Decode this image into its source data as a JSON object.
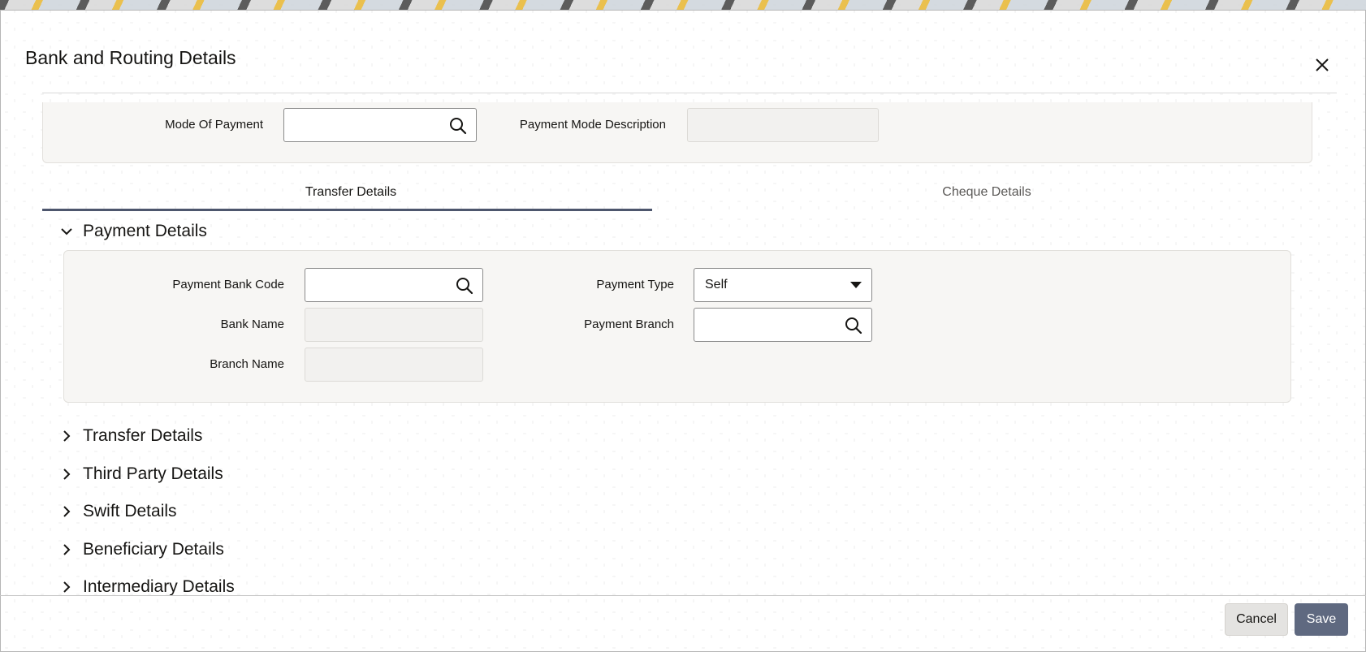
{
  "dialog": {
    "title": "Bank and Routing Details",
    "close_icon": "close-icon"
  },
  "header": {
    "mode_of_payment": {
      "label": "Mode Of Payment",
      "value": ""
    },
    "payment_mode_description": {
      "label": "Payment Mode Description",
      "value": ""
    }
  },
  "tabs": [
    {
      "label": "Transfer Details",
      "active": true
    },
    {
      "label": "Cheque Details",
      "active": false
    }
  ],
  "sections": {
    "payment_details": {
      "title": "Payment Details",
      "expanded": true,
      "fields": {
        "payment_bank_code": {
          "label": "Payment Bank Code",
          "value": ""
        },
        "bank_name": {
          "label": "Bank Name",
          "value": ""
        },
        "branch_name": {
          "label": "Branch Name",
          "value": ""
        },
        "payment_type": {
          "label": "Payment Type",
          "value": "Self"
        },
        "payment_branch": {
          "label": "Payment Branch",
          "value": ""
        }
      }
    },
    "collapsed": [
      {
        "title": "Transfer Details"
      },
      {
        "title": "Third Party Details"
      },
      {
        "title": "Swift Details"
      },
      {
        "title": "Beneficiary Details"
      },
      {
        "title": "Intermediary Details"
      }
    ]
  },
  "footer": {
    "cancel_label": "Cancel",
    "save_label": "Save"
  },
  "colors": {
    "primary_button": "#5f6980",
    "tab_underline": "#4d566d"
  }
}
